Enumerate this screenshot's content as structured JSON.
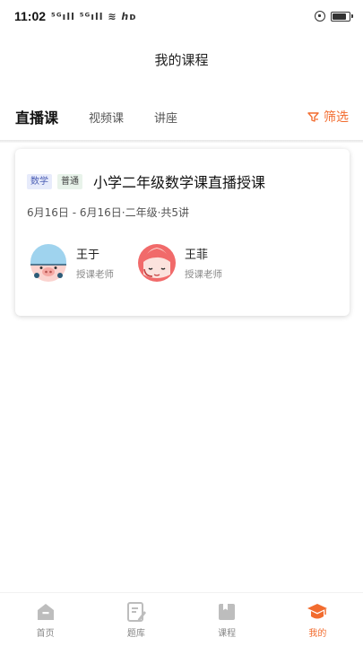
{
  "status": {
    "time": "11:02",
    "indicators": "⁵ᴳıll ⁵ᴳıll ≋ ℎᴅ",
    "battery_level": 0.85
  },
  "header": {
    "title": "我的课程"
  },
  "tabs": [
    {
      "label": "直播课",
      "active": true
    },
    {
      "label": "视频课",
      "active": false
    },
    {
      "label": "讲座",
      "active": false
    }
  ],
  "filter": {
    "label": "筛选",
    "icon": "filter-icon"
  },
  "course": {
    "tags": [
      "数学",
      "普通"
    ],
    "name": "小学二年级数学课直播授课",
    "meta": "6月16日 - 6月16日·二年级·共5讲",
    "teachers": [
      {
        "name": "王于",
        "role": "授课老师",
        "avatar": "pig-helmet-avatar"
      },
      {
        "name": "王菲",
        "role": "授课老师",
        "avatar": "girl-headset-avatar"
      }
    ]
  },
  "nav": [
    {
      "label": "首页",
      "icon": "home-icon",
      "active": false
    },
    {
      "label": "题库",
      "icon": "question-bank-icon",
      "active": false
    },
    {
      "label": "课程",
      "icon": "course-icon",
      "active": false
    },
    {
      "label": "我的",
      "icon": "graduation-cap-icon",
      "active": true
    }
  ],
  "colors": {
    "accent": "#f26c2f",
    "inactive": "#888888"
  }
}
